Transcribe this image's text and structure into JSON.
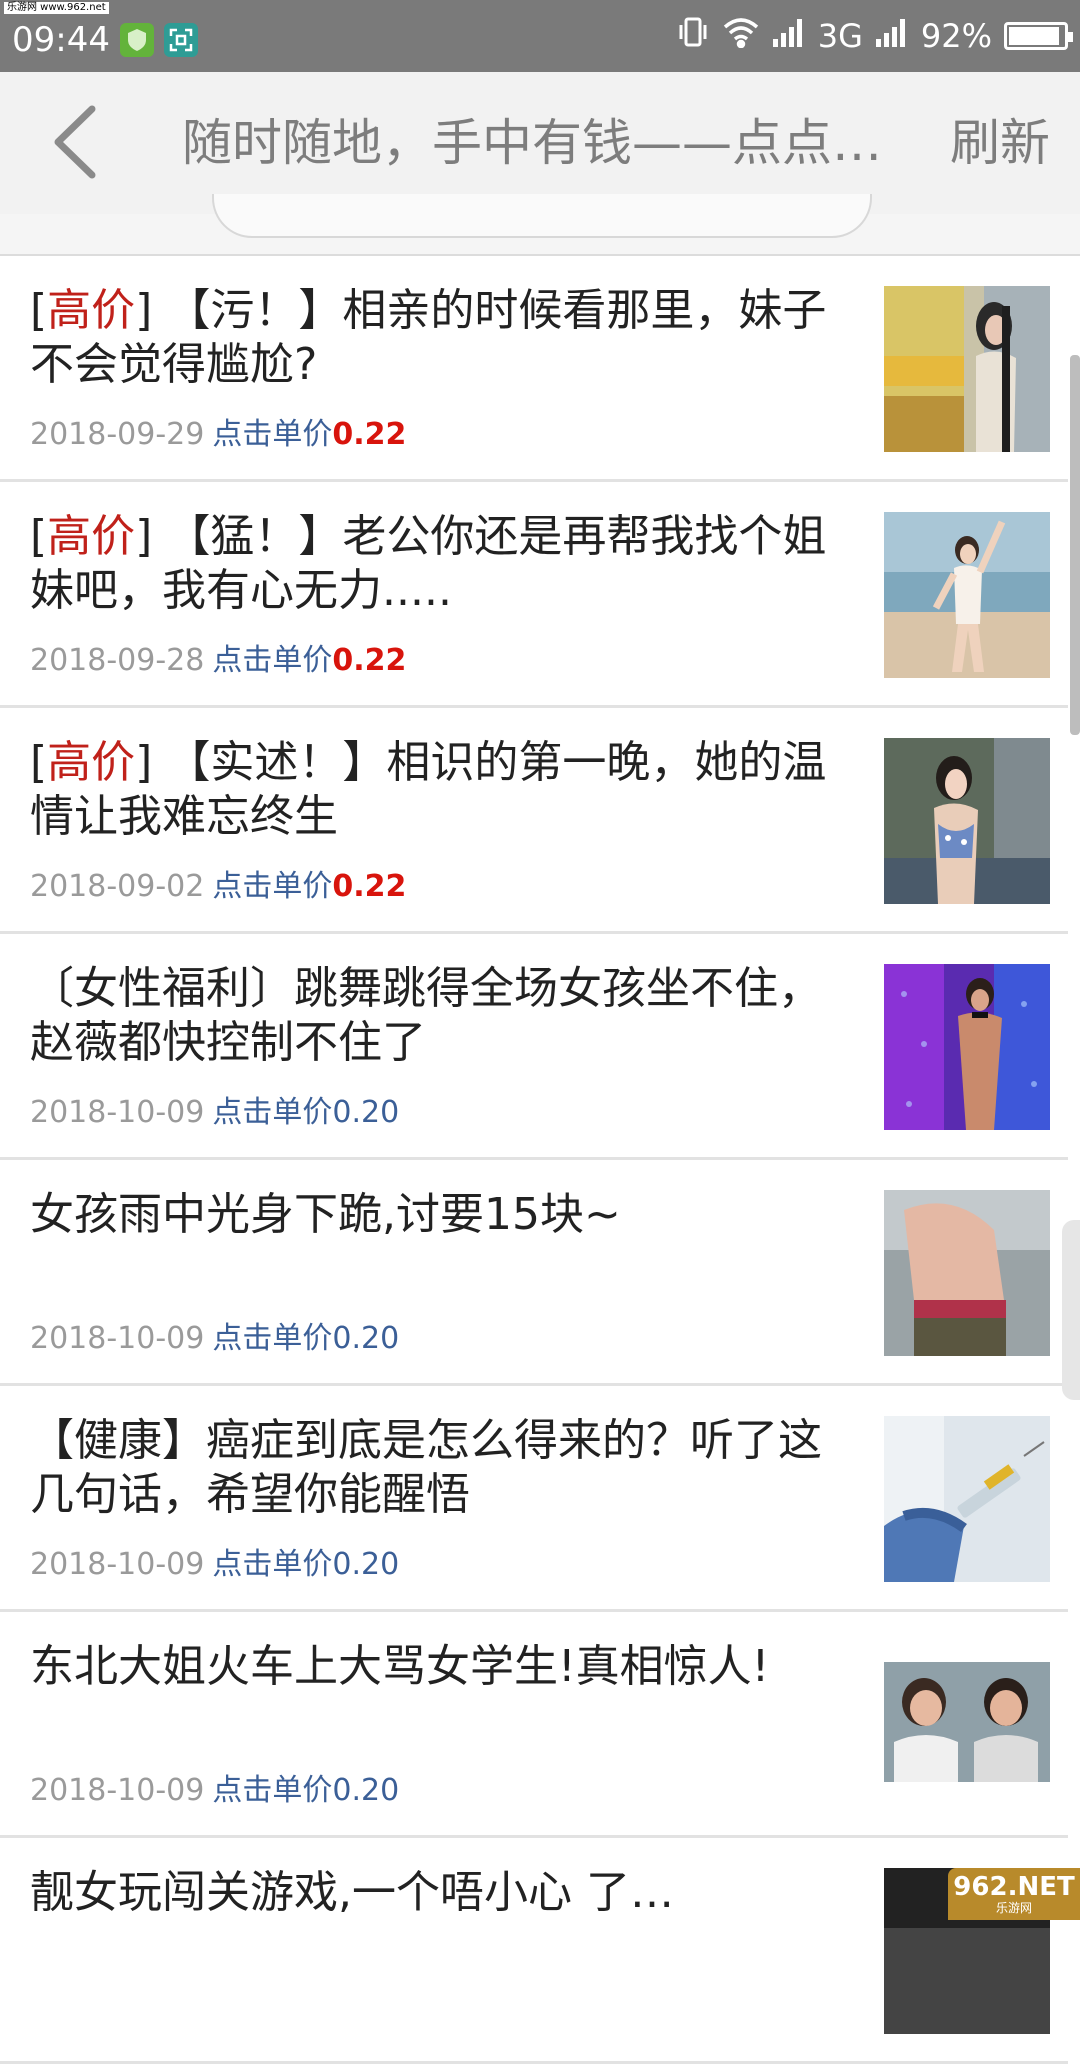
{
  "status_bar": {
    "watermark": "乐游网 www.962.net",
    "time": "09:44",
    "network": "3G",
    "battery_percent": "92%",
    "battery_level": 0.92,
    "icons": [
      "shield-app-icon",
      "scan-app-icon",
      "vibrate-icon",
      "wifi-icon",
      "signal-icon",
      "signal-icon",
      "battery-icon"
    ]
  },
  "nav": {
    "back_icon": "chevron-left-icon",
    "title": "随时随地，手中有钱——点点…",
    "refresh_label": "刷新"
  },
  "list": {
    "price_label": "点击单价",
    "items": [
      {
        "tag_open": "[",
        "tag": "高价",
        "tag_close": "]",
        "title": " 【污！】相亲的时候看那里，妹子不会觉得尴尬?",
        "date": "2018-09-29",
        "price": "0.22",
        "high": true,
        "thumb": "woman-in-store"
      },
      {
        "tag_open": "[",
        "tag": "高价",
        "tag_close": "]",
        "title": " 【猛！】老公你还是再帮我找个姐妹吧，我有心无力.....",
        "date": "2018-09-28",
        "price": "0.22",
        "high": true,
        "thumb": "woman-on-beach"
      },
      {
        "tag_open": "[",
        "tag": "高价",
        "tag_close": "]",
        "title": " 【实述！】相识的第一晚，她的温情让我难忘终生",
        "date": "2018-09-02",
        "price": "0.22",
        "high": true,
        "thumb": "woman-poolside"
      },
      {
        "tag_open": "",
        "tag": "",
        "tag_close": "",
        "title": "〔女性福利〕跳舞跳得全场女孩坐不住，赵薇都快控制不住了",
        "date": "2018-10-09",
        "price": "0.20",
        "high": false,
        "thumb": "dancer-stage"
      },
      {
        "tag_open": "",
        "tag": "",
        "tag_close": "",
        "title": "女孩雨中光身下跪,讨要15块~",
        "date": "2018-10-09",
        "price": "0.20",
        "high": false,
        "thumb": "person-back"
      },
      {
        "tag_open": "",
        "tag": "",
        "tag_close": "",
        "title": "【健康】癌症到底是怎么得来的？听了这几句话，希望你能醒悟",
        "date": "2018-10-09",
        "price": "0.20",
        "high": false,
        "thumb": "syringe-gloves"
      },
      {
        "tag_open": "",
        "tag": "",
        "tag_close": "",
        "title": "东北大姐火车上大骂女学生!真相惊人!",
        "date": "2018-10-09",
        "price": "0.20",
        "high": false,
        "thumb": "women-train"
      },
      {
        "tag_open": "",
        "tag": "",
        "tag_close": "",
        "title": "靓女玩闯关游戏,一个唔小心 了…",
        "date": "",
        "price": "",
        "high": false,
        "thumb": "game-show"
      }
    ]
  },
  "watermark_bottom": {
    "main": "962.NET",
    "sub": "乐游网"
  },
  "colors": {
    "status_bar": "#7a7a7a",
    "nav_bg": "#f2f2f2",
    "tag_red": "#c0211a",
    "price_high": "#d8140c",
    "price_blue": "#3b5f97",
    "date_gray": "#9a9a9a"
  }
}
